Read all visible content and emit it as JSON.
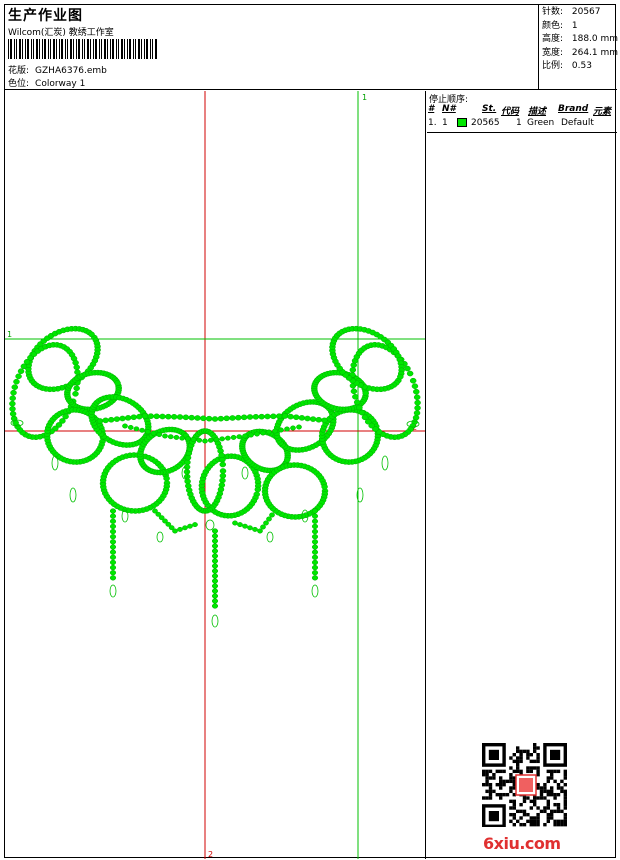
{
  "header": {
    "title": "生产作业图",
    "company": "Wilcom(汇炭) 教绣工作室",
    "design_label": "花版:",
    "design_value": "GZHA6376.emb",
    "colorway_label": "色位:",
    "colorway_value": "Colorway 1"
  },
  "stats": [
    {
      "label": "针数:",
      "value": "20567"
    },
    {
      "label": "颜色:",
      "value": "1"
    },
    {
      "label": "高度:",
      "value": "188.0 mm"
    },
    {
      "label": "宽度:",
      "value": "264.1 mm"
    },
    {
      "label": "比例:",
      "value": "0.53"
    }
  ],
  "guides": {
    "top_marker": "1",
    "left_marker": "1",
    "right_marker": "2",
    "bottom_marker": "2"
  },
  "sequence": {
    "title": "停止顺序:",
    "columns": [
      "#",
      "N#",
      "St.",
      "代码",
      "描述",
      "Brand",
      "元素"
    ],
    "rows": [
      {
        "index": "1.",
        "n": "1",
        "stitches": "20565",
        "code": "1",
        "description": "Green",
        "brand": "Default",
        "color": "#00e600"
      }
    ]
  },
  "watermark": "6xiu.com",
  "colors": {
    "thread": "#00e600",
    "guide_red": "#d00000",
    "guide_green": "#00c000"
  }
}
